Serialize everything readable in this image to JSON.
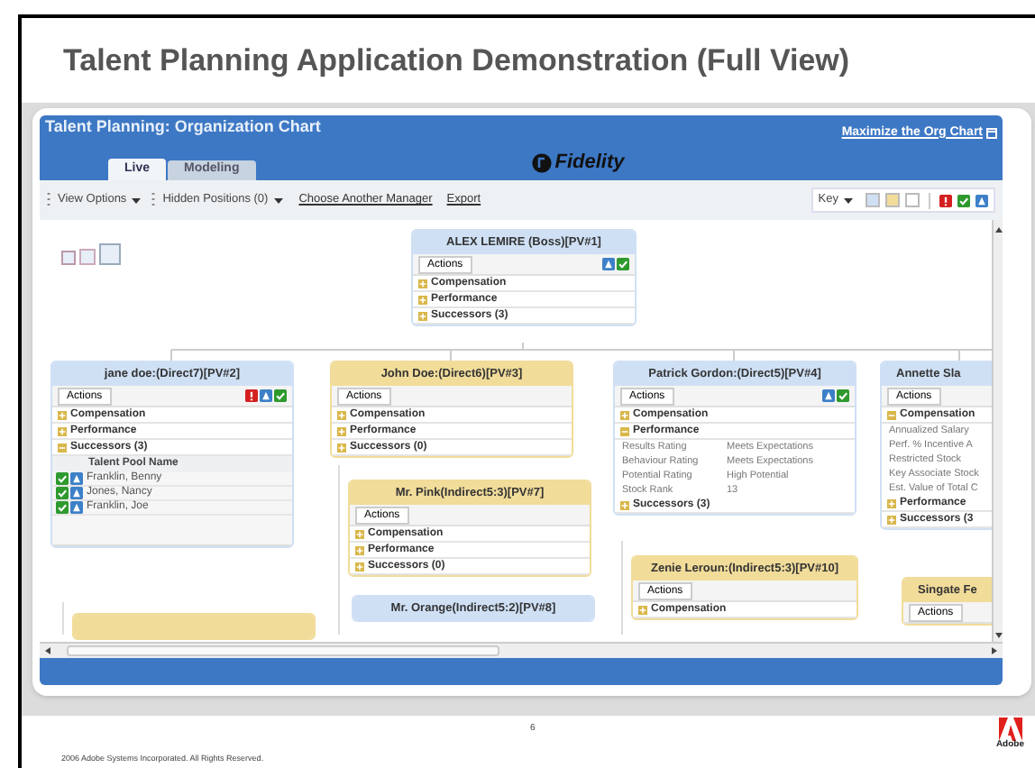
{
  "slide": {
    "title": "Talent Planning Application Demonstration (Full View)",
    "copyright": "2006 Adobe Systems Incorporated. All Rights Reserved.",
    "page_number": "6",
    "logo_text": "Adobe"
  },
  "app": {
    "title": "Talent Planning: Organization Chart",
    "logo_text": "Fidelity",
    "maximize_link": "Maximize the Org Chart",
    "tabs": [
      {
        "label": "Live",
        "selected": true
      },
      {
        "label": "Modeling",
        "selected": false
      }
    ],
    "toolbar": [
      {
        "kind": "dropdown",
        "label": "View Options"
      },
      {
        "kind": "dropdown",
        "label": "Hidden Positions (0)"
      },
      {
        "kind": "link",
        "label": "Choose Another Manager"
      },
      {
        "kind": "link",
        "label": "Export"
      }
    ],
    "key": {
      "label": "Key",
      "swatches": [
        {
          "color": "#cfe0f5"
        },
        {
          "color": "#f1dc9a"
        },
        {
          "color": "#ffffff"
        }
      ],
      "status_icons": [
        {
          "kind": "alert"
        },
        {
          "kind": "check"
        },
        {
          "kind": "info"
        }
      ]
    }
  },
  "nodes": [
    {
      "title": "ALEX LEMIRE (Boss)[PV#1]",
      "color": "#cfe0f5",
      "actions": "Actions",
      "status": [
        {
          "kind": "info"
        },
        {
          "kind": "check"
        }
      ],
      "sections": [
        {
          "label": "Compensation",
          "expanded": false
        },
        {
          "label": "Performance",
          "expanded": false
        },
        {
          "label": "Successors (3)",
          "expanded": false
        }
      ]
    },
    {
      "title": "jane doe:(Direct7)[PV#2]",
      "color": "#cfe0f5",
      "actions": "Actions",
      "status": [
        {
          "kind": "alert"
        },
        {
          "kind": "info"
        },
        {
          "kind": "check"
        }
      ],
      "sections": [
        {
          "label": "Compensation",
          "expanded": false
        },
        {
          "label": "Performance",
          "expanded": false
        },
        {
          "label": "Successors (3)",
          "expanded": true,
          "pool": {
            "header": "Talent Pool Name",
            "rows": [
              {
                "name": "Franklin, Benny",
                "status": [
                  {
                    "kind": "check"
                  },
                  {
                    "kind": "info"
                  }
                ]
              },
              {
                "name": "Jones, Nancy",
                "status": [
                  {
                    "kind": "check"
                  },
                  {
                    "kind": "info"
                  }
                ]
              },
              {
                "name": "Franklin, Joe",
                "status": [
                  {
                    "kind": "check"
                  },
                  {
                    "kind": "info"
                  }
                ]
              }
            ]
          }
        }
      ]
    },
    {
      "title": "John Doe:(Direct6)[PV#3]",
      "color": "#f1dc9a",
      "actions": "Actions",
      "sections": [
        {
          "label": "Compensation",
          "expanded": false
        },
        {
          "label": "Performance",
          "expanded": false
        },
        {
          "label": "Successors (0)",
          "expanded": false
        }
      ]
    },
    {
      "title": "Patrick Gordon:(Direct5)[PV#4]",
      "color": "#cfe0f5",
      "actions": "Actions",
      "status": [
        {
          "kind": "info"
        },
        {
          "kind": "check"
        }
      ],
      "sections": [
        {
          "label": "Compensation",
          "expanded": false
        },
        {
          "label": "Performance",
          "expanded": true,
          "details": [
            {
              "label": "Results Rating",
              "value": "Meets Expectations"
            },
            {
              "label": "Behaviour Rating",
              "value": "Meets Expectations"
            },
            {
              "label": "Potential Rating",
              "value": "High Potential"
            },
            {
              "label": "Stock Rank",
              "value": "13"
            }
          ]
        },
        {
          "label": "Successors (3)",
          "expanded": false
        }
      ]
    },
    {
      "title": "Annette Sla",
      "color": "#cfe0f5",
      "actions": "Actions",
      "sections": [
        {
          "label": "Compensation",
          "expanded": true,
          "details": [
            {
              "label": "Annualized Salary"
            },
            {
              "label": "Perf. % Incentive A"
            },
            {
              "label": "Restricted Stock"
            },
            {
              "label": "Key Associate Stock"
            },
            {
              "label": "Est. Value of Total C"
            }
          ]
        },
        {
          "label": "Performance",
          "expanded": false
        },
        {
          "label": "Successors (3",
          "expanded": false
        }
      ]
    },
    {
      "title": "Mr. Pink(Indirect5:3)[PV#7]",
      "color": "#f1dc9a",
      "actions": "Actions",
      "sections": [
        {
          "label": "Compensation",
          "expanded": false
        },
        {
          "label": "Performance",
          "expanded": false
        },
        {
          "label": "Successors (0)",
          "expanded": false
        }
      ]
    },
    {
      "title": "Mr. Orange(Indirect5:2)[PV#8]",
      "color": "#cfe0f5"
    },
    {
      "title": "Zenie Leroun:(Indirect5:3)[PV#10]",
      "color": "#f1dc9a",
      "actions": "Actions",
      "sections": [
        {
          "label": "Compensation",
          "expanded": false
        }
      ]
    },
    {
      "title": "Singate Fe",
      "color": "#f1dc9a",
      "actions": "Actions"
    },
    {
      "color": "#f1dc9a"
    }
  ]
}
